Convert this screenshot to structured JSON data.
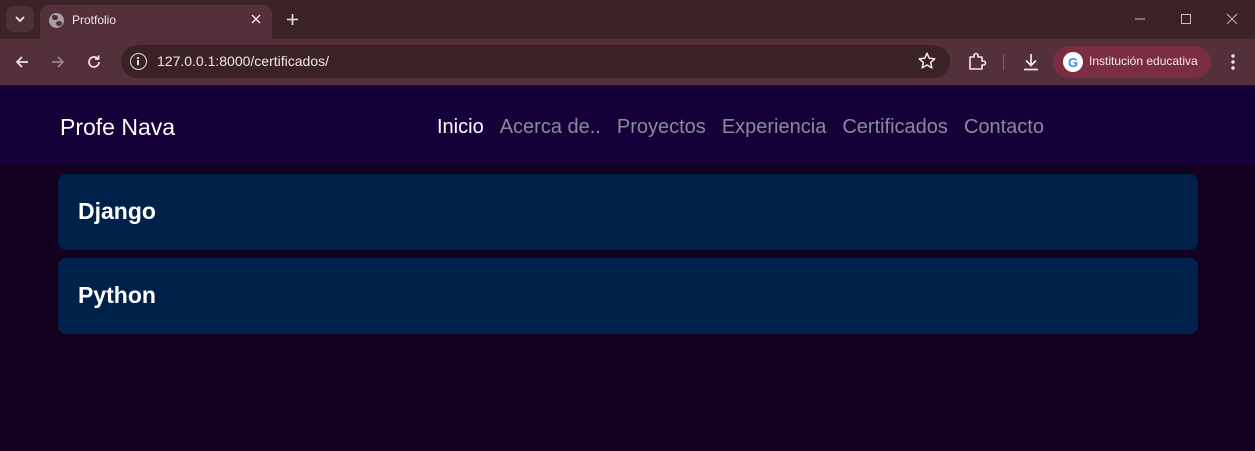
{
  "browser": {
    "tab_title": "Protfolio",
    "url": "127.0.0.1:8000/certificados/",
    "profile_label": "Institución educativa"
  },
  "site": {
    "brand": "Profe Nava",
    "nav": [
      {
        "label": "Inicio",
        "active": true
      },
      {
        "label": "Acerca de..",
        "active": false
      },
      {
        "label": "Proyectos",
        "active": false
      },
      {
        "label": "Experiencia",
        "active": false
      },
      {
        "label": "Certificados",
        "active": false
      },
      {
        "label": "Contacto",
        "active": false
      }
    ]
  },
  "certificates": [
    {
      "title": "Django"
    },
    {
      "title": "Python"
    }
  ],
  "colors": {
    "page_bg": "#14001f",
    "navbar_bg": "#15003a",
    "card_bg": "#00224a",
    "tab_bg": "#54303a",
    "profile_chip": "#7b2e43"
  }
}
